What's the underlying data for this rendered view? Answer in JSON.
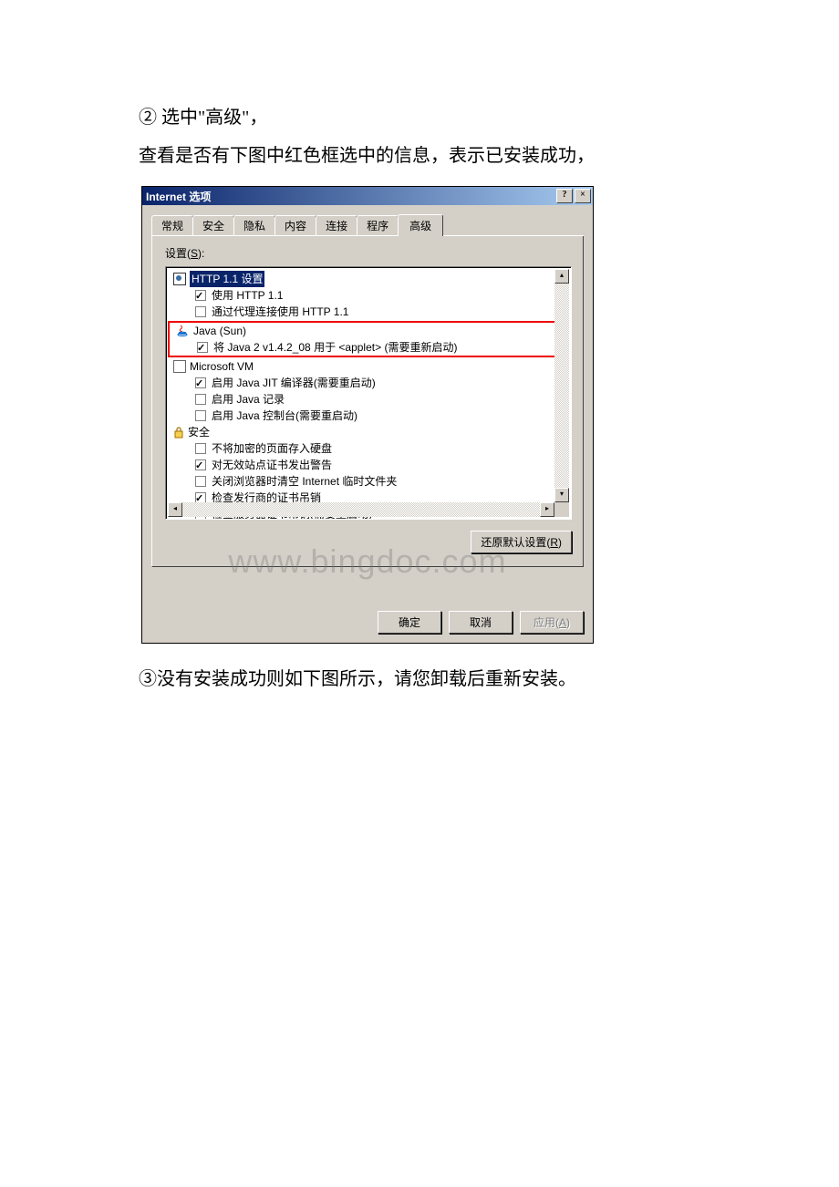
{
  "text": {
    "line1": "② 选中\"高级\"，",
    "line2": "查看是否有下图中红色框选中的信息，表示已安装成功，",
    "line3": "③没有安装成功则如下图所示，请您卸载后重新安装。"
  },
  "dialog": {
    "title": "Internet 选项",
    "help_btn": "?",
    "close_btn": "×",
    "tabs": [
      "常规",
      "安全",
      "隐私",
      "内容",
      "连接",
      "程序",
      "高级"
    ],
    "active_tab": "高级",
    "settings_label": "设置(S):",
    "tree": {
      "http": {
        "label": "HTTP 1.1 设置",
        "items": [
          {
            "checked": true,
            "label": "使用 HTTP 1.1"
          },
          {
            "checked": false,
            "label": "通过代理连接使用 HTTP 1.1"
          }
        ]
      },
      "java": {
        "label": "Java (Sun)",
        "items": [
          {
            "checked": true,
            "label": "将 Java 2 v1.4.2_08 用于 <applet> (需要重新启动)"
          }
        ]
      },
      "msvm": {
        "label": "Microsoft VM",
        "items": [
          {
            "checked": true,
            "label": "启用 Java JIT 编译器(需要重启动)"
          },
          {
            "checked": false,
            "label": "启用 Java 记录"
          },
          {
            "checked": false,
            "label": "启用 Java 控制台(需要重启动)"
          }
        ]
      },
      "security": {
        "label": "安全",
        "items": [
          {
            "checked": false,
            "label": "不将加密的页面存入硬盘"
          },
          {
            "checked": true,
            "label": "对无效站点证书发出警告"
          },
          {
            "checked": false,
            "label": "关闭浏览器时清空 Internet 临时文件夹"
          },
          {
            "checked": true,
            "label": "检查发行商的证书吊销"
          },
          {
            "checked": false,
            "label": "检查服务器证书吊销(需要重启动)"
          }
        ]
      }
    },
    "restore_btn": "还原默认设置(R)",
    "ok_btn": "确定",
    "cancel_btn": "取消",
    "apply_btn": "应用(A)"
  },
  "watermark": "www.bingdoc.com"
}
